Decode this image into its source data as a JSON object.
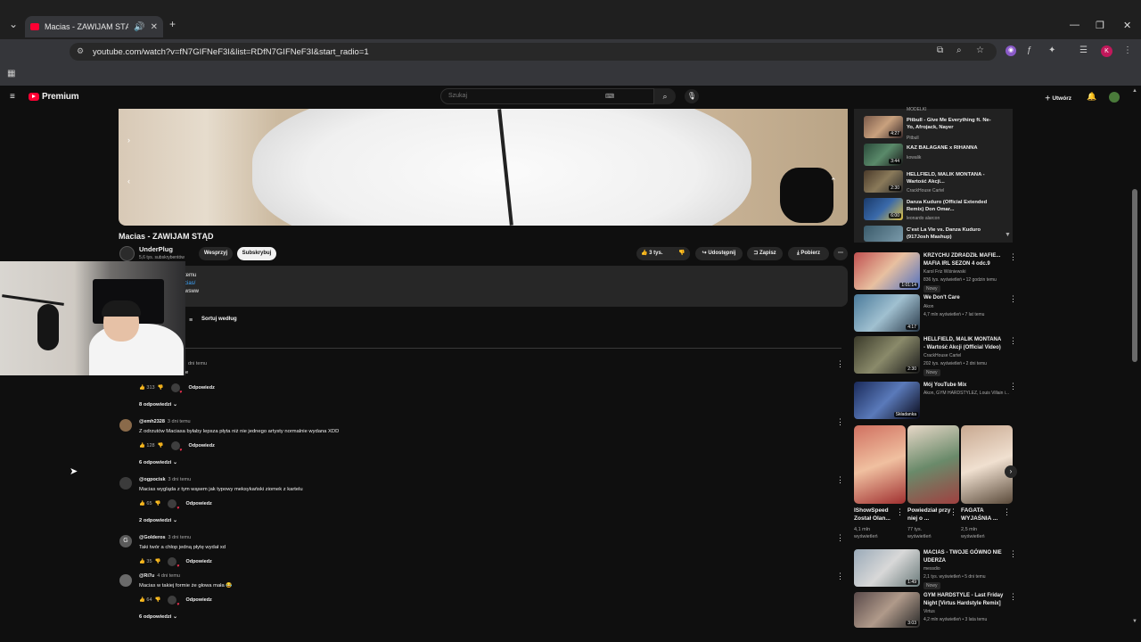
{
  "browser": {
    "tab_title": "Macias - ZAWIJAM STĄD - Y",
    "url": "youtube.com/watch?v=fN7GIFNeF3I&list=RDfN7GIFNeF3I&start_radio=1",
    "profile_letter": "K"
  },
  "youtube": {
    "logo_text": "Premium",
    "search_placeholder": "Szukaj",
    "create_label": "Utwórz"
  },
  "video": {
    "title": "Macias - ZAWIJAM STĄD",
    "channel": "UnderPlug",
    "subscribers": "5,6 tys. subskrybentów",
    "support": "Wesprzyj",
    "subscribe": "Subskrybuj",
    "likes": "3 tys.",
    "share": "Udostępnij",
    "save": "Zapisz",
    "download": "Pobierz",
    "desc_lines": [
      "temu",
      "cias/",
      "wsww"
    ],
    "sort_label": "Sortuj według"
  },
  "comments": [
    {
      "user": "",
      "time": "dni temu",
      "text": "e",
      "likes": "313",
      "replies": "8 odpowiedzi",
      "reply_label": "Odpowiedz"
    },
    {
      "user": "@emh2328",
      "time": "3 dni temu",
      "text": "Z odrzutów Maciasa byłaby lepsza płyta niż nie jednego artysty normalnie wydana XDD",
      "likes": "128",
      "replies": "6 odpowiedzi",
      "reply_label": "Odpowiedz"
    },
    {
      "user": "@ogpocisk",
      "time": "3 dni temu",
      "text": "Macias wygląda z tym wąsem jak typowy meksykański ziomek z kartelu",
      "likes": "65",
      "replies": "2 odpowiedzi",
      "reply_label": "Odpowiedz"
    },
    {
      "user": "@Golderos",
      "time": "3 dni temu",
      "text": "Taki twór a chłop jedną płytę wydał xd",
      "likes": "35",
      "replies": "",
      "reply_label": "Odpowiedz"
    },
    {
      "user": "@Ri7u",
      "time": "4 dni temu",
      "text": "Macias w takiej formie że głowa mała 😂",
      "likes": "64",
      "replies": "6 odpowiedzi",
      "reply_label": "Odpowiedz"
    }
  ],
  "mix": [
    {
      "title": "",
      "channel": "MODELKI",
      "dur": ""
    },
    {
      "title": "Pitbull - Give Me Everything ft. Ne-Yo, Afrojack, Nayer",
      "channel": "Pitbull",
      "dur": "4:27"
    },
    {
      "title": "KAZ BALAGANE x RIHANNA",
      "channel": "kowalik",
      "dur": "3:44"
    },
    {
      "title": "HELLFIELD, MALIK MONTANA - Wartość Akcji...",
      "channel": "CrackHouse Cartel",
      "dur": "2:30"
    },
    {
      "title": "Danza Kuduro (Official Extended Remix) Don Omar...",
      "channel": "leonardo alarcon",
      "dur": "6:00"
    },
    {
      "title": "C'est La Vie vs. Danza Kuduro (917Josh Mashup)",
      "channel": "",
      "dur": ""
    }
  ],
  "recommended": [
    {
      "title": "KRZYCHU ZDRADZIŁ MAFIE... MAFIA IRL SEZON 4 odc.9",
      "channel": "Karol Friz Wiśniewski",
      "meta": "836 tys. wyświetleń • 12 godzin temu",
      "badge": "Nowy",
      "dur": "1:01:14"
    },
    {
      "title": "We Don't Care",
      "channel": "Akon",
      "meta": "4,7 mln wyświetleń • 7 lat temu",
      "badge": "",
      "dur": "4:17"
    },
    {
      "title": "HELLFIELD, MALIK MONTANA - Wartość Akcji (Official Video)",
      "channel": "CrackHouse Cartel",
      "meta": "202 tys. wyświetleń • 2 dni temu",
      "badge": "Nowy",
      "dur": "2:30"
    },
    {
      "title": "Mój YouTube Mix",
      "channel": "Akon, GYM HARDSTYLEZ, Louis Villain i...",
      "meta": "",
      "badge": "",
      "dur": "Składanka"
    },
    {
      "title": "MACIAS - TWOJE GÓWNO NIE UDERZA",
      "channel": "messdio",
      "meta": "2,1 tys. wyświetleń • 5 dni temu",
      "badge": "Nowy",
      "dur": "1:49"
    },
    {
      "title": "GYM HARDSTYLE - Last Friday Night [Virtus Hardstyle Remix]",
      "channel": "Virtus",
      "meta": "4,2 mln wyświetleń • 3 lata temu",
      "badge": "",
      "dur": "3:03"
    }
  ],
  "shorts": [
    {
      "title": "IShowSpeed Został Olan...",
      "views": "4,1 mln wyświetleń"
    },
    {
      "title": "Powiedział przy niej o ...",
      "views": "77 tys. wyświetleń"
    },
    {
      "title": "FAGATA WYJAŚNIA ...",
      "views": "2,5 mln wyświetleń"
    }
  ],
  "colors": {
    "accent": "#ff0033",
    "background": "#0f0f0f",
    "panel": "#272727"
  }
}
